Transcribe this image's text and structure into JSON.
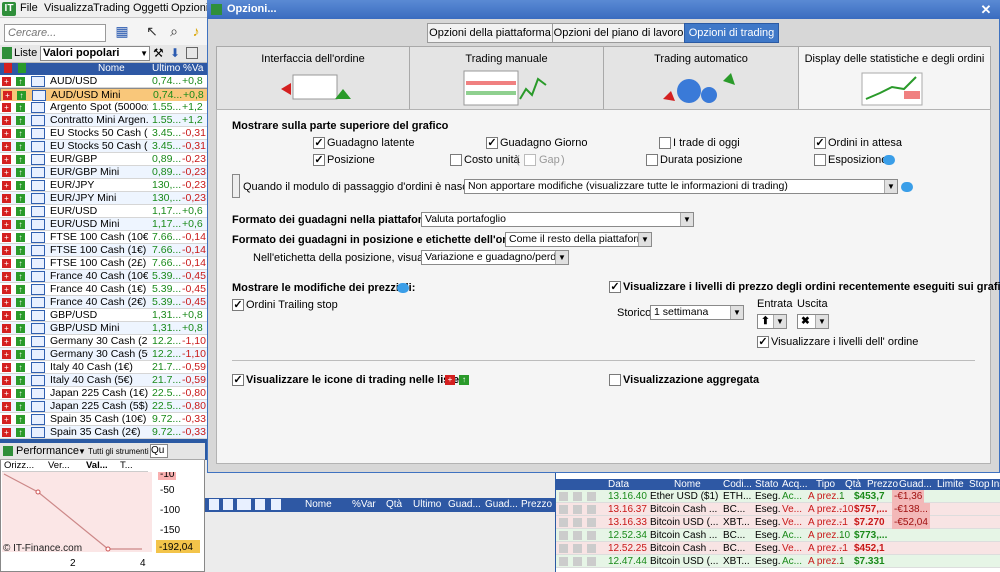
{
  "menubar": {
    "logo": "IT",
    "items": [
      "File",
      "Visualizza",
      "Trading",
      "Oggetti",
      "Opzioni"
    ]
  },
  "left": {
    "search_placeholder": "Cercare...",
    "lists_label": "Liste",
    "list_selected": "Valori popolari",
    "columns": [
      "Nome",
      "Ultimo",
      "%Va"
    ],
    "rows": [
      {
        "name": "AUD/USD",
        "last": "0,74...",
        "var": "+0,8",
        "pos": true
      },
      {
        "name": "AUD/USD Mini",
        "last": "0,74...",
        "var": "+0,8",
        "pos": true,
        "selected": true
      },
      {
        "name": "Argento Spot (5000oz)",
        "last": "1.55...",
        "var": "+1,2",
        "pos": true
      },
      {
        "name": "Contratto Mini Argen...",
        "last": "1.55...",
        "var": "+1,2",
        "pos": true
      },
      {
        "name": "EU Stocks 50 Cash (...",
        "last": "3.45...",
        "var": "-0,31",
        "pos": false
      },
      {
        "name": "EU Stocks 50 Cash (...",
        "last": "3.45...",
        "var": "-0,31",
        "pos": false
      },
      {
        "name": "EUR/GBP",
        "last": "0,89...",
        "var": "-0,23",
        "pos": false
      },
      {
        "name": "EUR/GBP Mini",
        "last": "0,89...",
        "var": "-0,23",
        "pos": false
      },
      {
        "name": "EUR/JPY",
        "last": "130,...",
        "var": "-0,23",
        "pos": false
      },
      {
        "name": "EUR/JPY Mini",
        "last": "130,...",
        "var": "-0,23",
        "pos": false
      },
      {
        "name": "EUR/USD",
        "last": "1,17...",
        "var": "+0,6",
        "pos": true
      },
      {
        "name": "EUR/USD Mini",
        "last": "1,17...",
        "var": "+0,6",
        "pos": true
      },
      {
        "name": "FTSE 100 Cash (10€)",
        "last": "7.66...",
        "var": "-0,14",
        "pos": false
      },
      {
        "name": "FTSE 100 Cash (1€)",
        "last": "7.66...",
        "var": "-0,14",
        "pos": false
      },
      {
        "name": "FTSE 100 Cash (2£)",
        "last": "7.66...",
        "var": "-0,14",
        "pos": false
      },
      {
        "name": "France 40 Cash (10€)",
        "last": "5.39...",
        "var": "-0,45",
        "pos": false
      },
      {
        "name": "France 40 Cash (1€)",
        "last": "5.39...",
        "var": "-0,45",
        "pos": false
      },
      {
        "name": "France 40 Cash (2€)",
        "last": "5.39...",
        "var": "-0,45",
        "pos": false
      },
      {
        "name": "GBP/USD",
        "last": "1,31...",
        "var": "+0,8",
        "pos": true
      },
      {
        "name": "GBP/USD Mini",
        "last": "1,31...",
        "var": "+0,8",
        "pos": true
      },
      {
        "name": "Germany 30 Cash (2...",
        "last": "12.2...",
        "var": "-1,10",
        "pos": false
      },
      {
        "name": "Germany 30 Cash (5€)",
        "last": "12.2...",
        "var": "-1,10",
        "pos": false
      },
      {
        "name": "Italy 40 Cash (1€)",
        "last": "21.7...",
        "var": "-0,59",
        "pos": false
      },
      {
        "name": "Italy 40 Cash (5€)",
        "last": "21.7...",
        "var": "-0,59",
        "pos": false
      },
      {
        "name": "Japan 225 Cash (1€)",
        "last": "22.5...",
        "var": "-0,80",
        "pos": false
      },
      {
        "name": "Japan 225 Cash (5$)",
        "last": "22.5...",
        "var": "-0,80",
        "pos": false
      },
      {
        "name": "Spain 35 Cash (10€)",
        "last": "9.72...",
        "var": "-0,33",
        "pos": false
      },
      {
        "name": "Spain 35 Cash (2€)",
        "last": "9.72...",
        "var": "-0,33",
        "pos": false
      }
    ]
  },
  "perf": {
    "title": "Performance",
    "filter": "Tutti gli strumenti",
    "qu": "Qu",
    "cols": [
      "Orizz...",
      "Ver...",
      "Val...",
      "T..."
    ],
    "yticks": [
      "-10",
      "-50",
      "-100",
      "-150"
    ],
    "value": "-192,04",
    "xticks": [
      "2",
      "4"
    ],
    "watermark": "© IT-Finance.com"
  },
  "mid": {
    "columns": [
      "Nome",
      "%Var",
      "Qtà",
      "Ultimo",
      "Guad...",
      "Guad...",
      "Prezzo"
    ]
  },
  "orders": {
    "columns": [
      "Data",
      "Nome",
      "Codi...",
      "Stato",
      "Acq...",
      "Tipo",
      "Qtà",
      "Prezzo",
      "Guad...",
      "Limite",
      "Stop",
      "Ins"
    ],
    "rows": [
      {
        "time": "13.16.40",
        "name": "Ether USD ($1)",
        "code": "ETH...",
        "state": "Eseg.",
        "side": "Ac...",
        "type": "A prez...",
        "qty": "1",
        "price": "$453,7",
        "gain": "-€1,36",
        "cls": "g"
      },
      {
        "time": "13.16.37",
        "name": "Bitcoin Cash ...",
        "code": "BC...",
        "state": "Eseg.",
        "side": "Ve...",
        "type": "A prez...",
        "qty": "-10",
        "price": "$757,...",
        "gain": "-€138...",
        "cls": "r"
      },
      {
        "time": "13.16.33",
        "name": "Bitcoin USD (...",
        "code": "XBT...",
        "state": "Eseg.",
        "side": "Ve...",
        "type": "A prez...",
        "qty": "-1",
        "price": "$7.270",
        "gain": "-€52,04",
        "cls": "r"
      },
      {
        "time": "12.52.34",
        "name": "Bitcoin Cash ...",
        "code": "BC...",
        "state": "Eseg.",
        "side": "Ac...",
        "type": "A prez...",
        "qty": "10",
        "price": "$773,...",
        "gain": "",
        "cls": "g"
      },
      {
        "time": "12.52.25",
        "name": "Bitcoin Cash ...",
        "code": "BC...",
        "state": "Eseg.",
        "side": "Ve...",
        "type": "A prez...",
        "qty": "-1",
        "price": "$452,1",
        "gain": "",
        "cls": "r"
      },
      {
        "time": "12.47.44",
        "name": "Bitcoin USD (...",
        "code": "XBT...",
        "state": "Eseg.",
        "side": "Ac...",
        "type": "A prez...",
        "qty": "1",
        "price": "$7.331",
        "gain": "",
        "cls": "g"
      }
    ]
  },
  "dialog": {
    "title": "Opzioni...",
    "top_tabs": [
      "Opzioni della piattaforma",
      "Opzioni del piano di lavoro",
      "Opzioni di trading"
    ],
    "big_tabs": [
      "Interfaccia dell'ordine",
      "Trading manuale",
      "Trading automatico",
      "Display delle statistiche e degli ordini"
    ],
    "section_show": "Mostrare sulla parte superiore del grafico",
    "checks": {
      "guadagno_latente": "Guadagno latente",
      "guadagno_giorno": "Guadagno Giorno",
      "trade_oggi": "I trade di oggi",
      "ordini_attesa": "Ordini in attesa",
      "posizione": "Posizione",
      "costo_unita": "Costo unità",
      "gap": "Gap",
      "durata": "Durata posizione",
      "esposizione": "Esposizione"
    },
    "hidden_module_label": "Quando il modulo di passaggio d'ordini è nascosto:",
    "hidden_module_value": "Non apportare modifiche (visualizzare tutte le informazioni di trading)",
    "fmt_platform_label": "Formato dei guadagni nella piattaforma:",
    "fmt_platform_value": "Valuta portafoglio",
    "fmt_position_label": "Formato dei guadagni in posizione e etichette dell'ordine:",
    "fmt_position_value": "Come il resto della piattaforma",
    "label_position_label": "Nell'etichetta della posizione, visualizzare:",
    "label_position_value": "Variazione e guadagno/perdita",
    "price_changes": "Mostrare le modifiche dei prezzi di:",
    "trailing": "Ordini Trailing stop",
    "show_levels": "Visualizzare i livelli di prezzo degli ordini recentemente eseguiti sui grafici",
    "storico_label": "Storico",
    "storico_value": "1 settimana",
    "entrata": "Entrata",
    "uscita": "Uscita",
    "order_levels": "Visualizzare i livelli dell' ordine",
    "trade_icons": "Visualizzare le icone di trading nelle liste",
    "aggregata": "Visualizzazione aggregata"
  }
}
